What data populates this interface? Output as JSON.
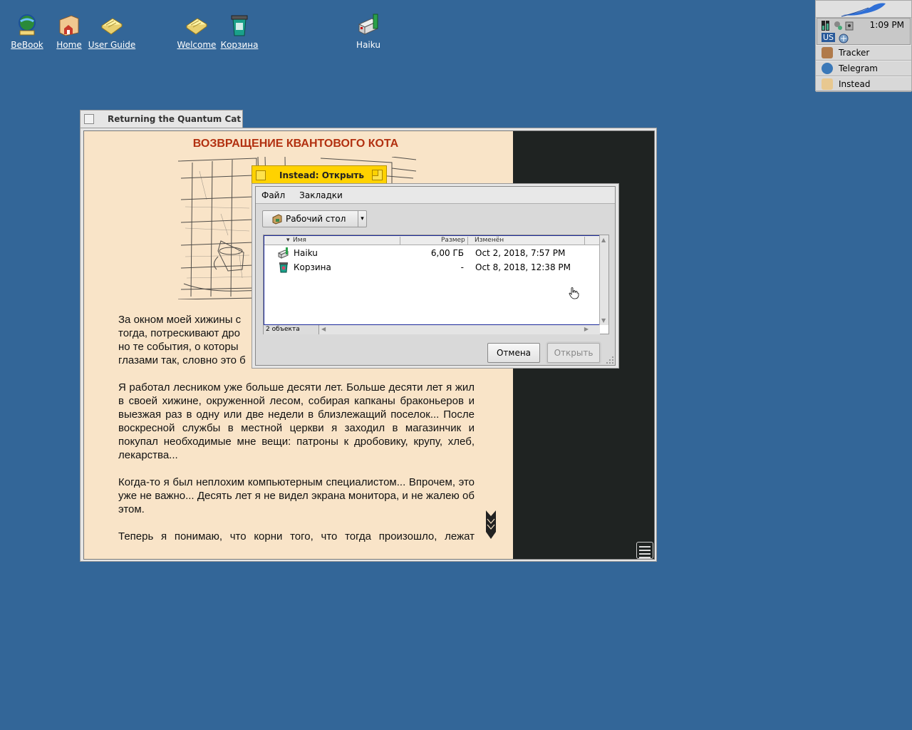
{
  "desktop": {
    "icons": [
      {
        "label": "BeBook"
      },
      {
        "label": "Home"
      },
      {
        "label": "User Guide"
      },
      {
        "label": "Welcome"
      },
      {
        "label": "Корзина"
      },
      {
        "label": "Haiku"
      }
    ]
  },
  "deskbar": {
    "clock": "1:09 PM",
    "keymap": "US",
    "apps": [
      {
        "label": "Tracker",
        "icon": "tracker-icon"
      },
      {
        "label": "Telegram",
        "icon": "telegram-icon"
      },
      {
        "label": "Instead",
        "icon": "instead-icon"
      }
    ]
  },
  "main_window": {
    "title": "Returning the Quantum Cat",
    "book_title": "ВОЗВРАЩЕНИЕ КВАНТОВОГО КОТА",
    "paragraphs": [
      "За окном моей хижины с",
      "тогда, потрескивают дро",
      "но те события, о которы",
      "глазами так, словно это б",
      "Я работал лесником уже больше десяти лет. Больше десяти лет я жил в своей хижине, окруженной лесом, собирая капканы браконьеров и выезжая раз в одну или две недели в близлежащий поселок... После воскресной службы в местной церкви я заходил в магазинчик и покупал необходимые мне вещи: патроны к дробовику, крупу, хлеб, лекарства...",
      "Когда-то я был неплохим компьютерным специалистом... Впрочем, это уже не важно... Десять лет я не видел экрана монитора, и не жалею об этом.",
      "Теперь я понимаю, что корни того, что тогда произошло, лежат"
    ]
  },
  "dialog": {
    "title": "Instead: Открыть",
    "menu": [
      "Файл",
      "Закладки"
    ],
    "location": "Рабочий стол",
    "columns": {
      "name": "Имя",
      "size": "Размер",
      "modified": "Изменён"
    },
    "files": [
      {
        "name": "Haiku",
        "size": "6,00 ГБ",
        "modified": "Oct 2, 2018, 7:57 PM"
      },
      {
        "name": "Корзина",
        "size": "-",
        "modified": "Oct 8, 2018, 12:38 PM"
      }
    ],
    "status": "2 объекта",
    "cancel": "Отмена",
    "open": "Открыть"
  },
  "colors": {
    "desktop": "#336698",
    "page": "#f9e4c8",
    "title_accent": "#b23010",
    "dialog_tab": "#ffd200"
  }
}
